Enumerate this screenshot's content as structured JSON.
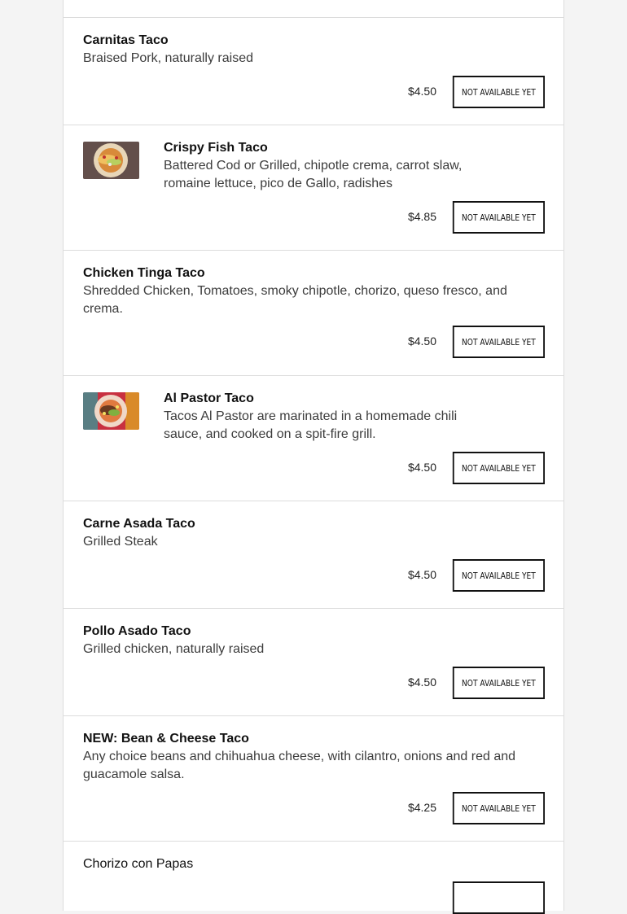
{
  "items": [
    {
      "name": "Carnitas Taco",
      "description": "Braised Pork, naturally raised",
      "price": "$4.50",
      "button": "Not available yet"
    },
    {
      "name": "Crispy Fish Taco",
      "description": "Battered Cod or Grilled, chipotle crema, carrot slaw, romaine lettuce, pico de Gallo, radishes",
      "price": "$4.85",
      "button": "Not available yet",
      "image": "fish-taco-photo"
    },
    {
      "name": "Chicken Tinga Taco",
      "description": "Shredded Chicken, Tomatoes, smoky chipotle, chorizo, queso fresco, and crema.",
      "price": "$4.50",
      "button": "Not available yet"
    },
    {
      "name": "Al Pastor Taco",
      "description": "Tacos Al Pastor are marinated in a homemade chili sauce, and cooked on a spit-fire grill.",
      "price": "$4.50",
      "button": "Not available yet",
      "image": "al-pastor-taco-photo"
    },
    {
      "name": "Carne Asada Taco",
      "description": "Grilled Steak",
      "price": "$4.50",
      "button": "Not available yet"
    },
    {
      "name": "Pollo Asado Taco",
      "description": "Grilled chicken, naturally raised",
      "price": "$4.50",
      "button": "Not available yet"
    },
    {
      "name": "NEW: Bean & Cheese Taco",
      "description": "Any choice beans and chihuahua cheese, with cilantro, onions and red and guacamole salsa.",
      "price": "$4.25",
      "button": "Not available yet"
    },
    {
      "name": "Chorizo con Papas"
    }
  ],
  "colors": {
    "background": "#f4f4f4",
    "card": "#ffffff",
    "border": "#dcdcdc",
    "button_border": "#111111"
  }
}
